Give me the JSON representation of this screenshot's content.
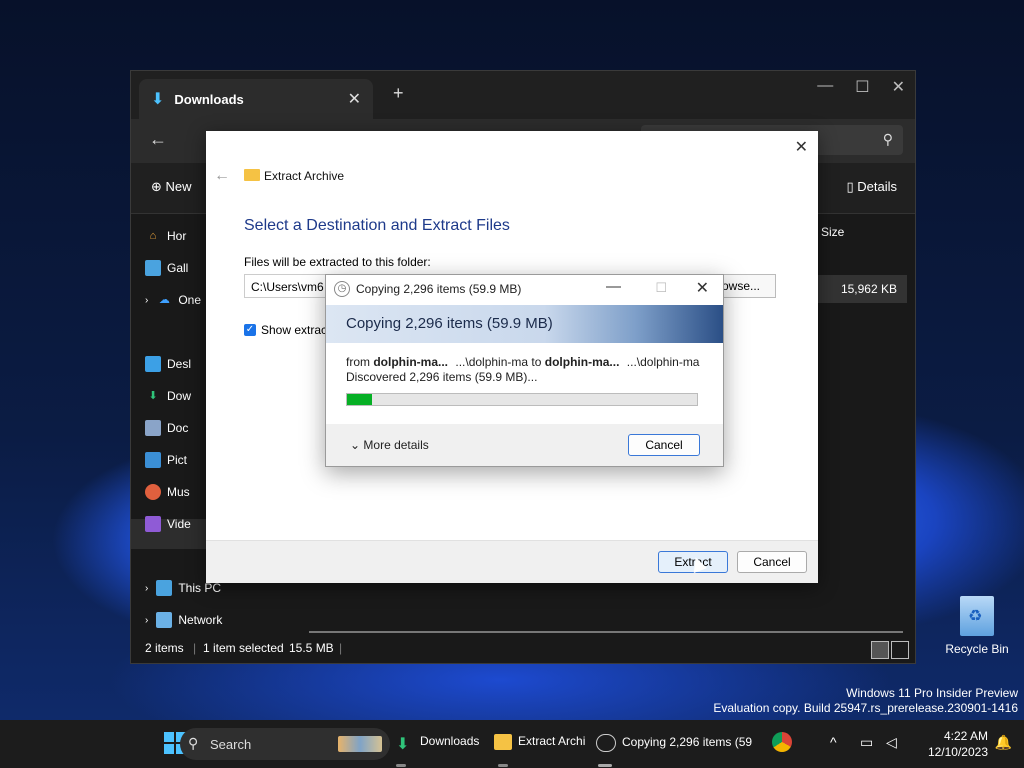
{
  "explorer": {
    "tab_title": "Downloads",
    "sidebar": [
      {
        "label": "Hor",
        "icon": "home-icon"
      },
      {
        "label": "Gall",
        "icon": "gallery-icon"
      },
      {
        "label": "One",
        "icon": "onedrive-icon"
      },
      {
        "label": "Desl",
        "icon": "desktop-icon"
      },
      {
        "label": "Dow",
        "icon": "downloads-icon"
      },
      {
        "label": "Doc",
        "icon": "documents-icon"
      },
      {
        "label": "Pict",
        "icon": "pictures-icon"
      },
      {
        "label": "Mus",
        "icon": "music-icon"
      },
      {
        "label": "Vide",
        "icon": "videos-icon"
      },
      {
        "label": "This PC",
        "icon": "this-pc-icon"
      },
      {
        "label": "Network",
        "icon": "network-icon"
      }
    ],
    "command_bar": {
      "new_label": "New",
      "details_label": "Details"
    },
    "column_header": "Size",
    "selected_row_size": "15,962 KB",
    "status": {
      "items": "2 items",
      "selected": "1 item selected",
      "size": "15.5 MB"
    }
  },
  "extract_dialog": {
    "title": "Extract Archive",
    "heading": "Select a Destination and Extract Files",
    "folder_label": "Files will be extracted to this folder:",
    "path": "C:\\Users\\vm6",
    "browse_label": "owse...",
    "checkbox_label": "Show extract",
    "extract_label": "Extract",
    "cancel_label": "Cancel"
  },
  "copy_dialog": {
    "title": "Copying 2,296 items (59.9 MB)",
    "banner": "Copying 2,296 items (59.9 MB)",
    "from_prefix": "from",
    "from_name": "dolphin-ma...",
    "from_path": "...\\dolphin-ma",
    "to_word": "to",
    "to_name": "dolphin-ma...",
    "to_path": "...\\dolphin-ma",
    "discovered": "Discovered 2,296 items (59.9 MB)...",
    "progress_fraction": 0.07,
    "more_details": "More details",
    "cancel_label": "Cancel"
  },
  "desktop": {
    "recycle_bin": "Recycle Bin",
    "watermark_line1": "Windows 11 Pro Insider Preview",
    "watermark_line2": "Evaluation copy. Build 25947.rs_prerelease.230901-1416"
  },
  "taskbar": {
    "search": "Search",
    "apps": [
      "Downloads",
      "Extract Archi",
      "Copying 2,296 items (59"
    ],
    "time": "4:22 AM",
    "date": "12/10/2023"
  }
}
